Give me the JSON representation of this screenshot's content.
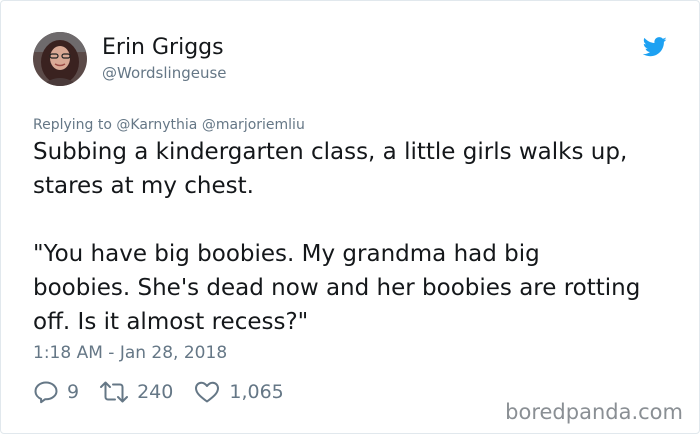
{
  "author": {
    "display_name": "Erin Griggs",
    "handle": "@Wordslingeuse"
  },
  "reply_context": "Replying to @Karnythia @marjoriemliu",
  "tweet": {
    "lines": [
      "Subbing a kindergarten class, a little girls walks up,",
      "stares at my chest.",
      "",
      "\"You have big boobies. My grandma had big",
      "boobies. She's dead now and her boobies are rotting",
      "off. Is it almost recess?\""
    ],
    "timestamp": "1:18 AM - Jan 28, 2018"
  },
  "actions": {
    "replies": "9",
    "retweets": "240",
    "likes": "1,065"
  },
  "icons": {
    "brand": "twitter-bird-icon",
    "reply": "reply-icon",
    "retweet": "retweet-icon",
    "like": "heart-icon"
  },
  "colors": {
    "brand_blue": "#1da1f2",
    "secondary_text": "#657786",
    "primary_text": "#14171a"
  },
  "watermark": "boredpanda.com"
}
